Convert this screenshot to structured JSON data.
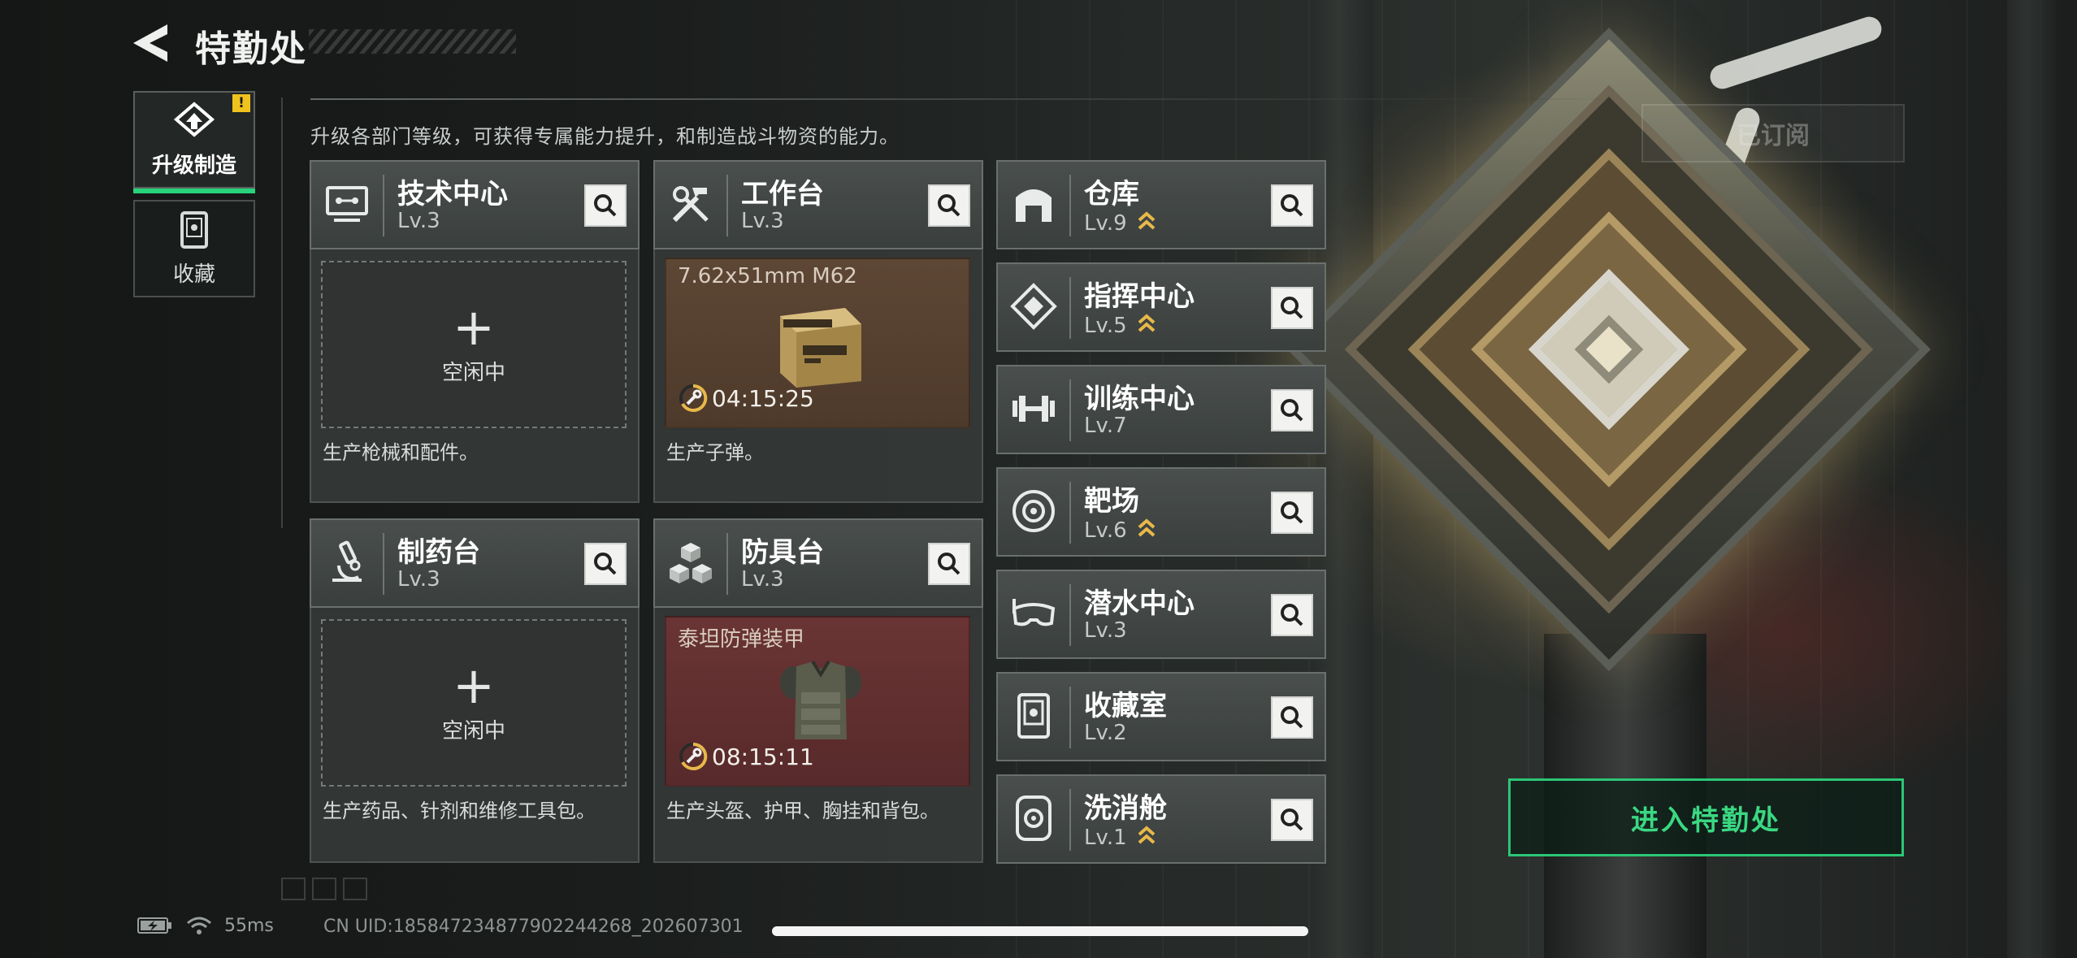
{
  "header": {
    "title": "特勤处"
  },
  "nav": {
    "tabs": [
      {
        "label": "升级制造",
        "active": true,
        "alert": "!"
      },
      {
        "label": "收藏",
        "active": false
      }
    ]
  },
  "subtitle": "升级各部门等级，可获得专属能力提升，和制造战斗物资的能力。",
  "workshops": [
    {
      "name": "技术中心",
      "level": "Lv.3",
      "icon": "monitor-icon",
      "status": "空闲中",
      "plus": "+",
      "desc": "生产枪械和配件。"
    },
    {
      "name": "工作台",
      "level": "Lv.3",
      "icon": "tools-icon",
      "product": "7.62x51mm M62",
      "timer": "04:15:25",
      "desc": "生产子弹。"
    },
    {
      "name": "制药台",
      "level": "Lv.3",
      "icon": "microscope-icon",
      "status": "空闲中",
      "plus": "+",
      "desc": "生产药品、针剂和维修工具包。"
    },
    {
      "name": "防具台",
      "level": "Lv.3",
      "icon": "cubes-icon",
      "product": "泰坦防弹装甲",
      "timer": "08:15:11",
      "desc": "生产头盔、护甲、胸挂和背包。"
    }
  ],
  "facilities": [
    {
      "name": "仓库",
      "level": "Lv.9",
      "upgradable": true,
      "icon": "warehouse-icon"
    },
    {
      "name": "指挥中心",
      "level": "Lv.5",
      "upgradable": true,
      "icon": "command-icon"
    },
    {
      "name": "训练中心",
      "level": "Lv.7",
      "upgradable": false,
      "icon": "dumbbell-icon"
    },
    {
      "name": "靶场",
      "level": "Lv.6",
      "upgradable": true,
      "icon": "target-icon"
    },
    {
      "name": "潜水中心",
      "level": "Lv.3",
      "upgradable": false,
      "icon": "diving-mask-icon"
    },
    {
      "name": "收藏室",
      "level": "Lv.2",
      "upgradable": false,
      "icon": "collection-icon"
    },
    {
      "name": "洗消舱",
      "level": "Lv.1",
      "upgradable": true,
      "icon": "decon-icon"
    }
  ],
  "subscribed_label": "已订阅",
  "enter_button": "进入特勤处",
  "status": {
    "ping": "55ms",
    "uid": "CN UID:1858472348779022442​68_202607301",
    "battery": "charging",
    "wifi": "connected"
  },
  "colors": {
    "accent": "#2cc676",
    "alert": "#f0c21e",
    "upgrade": "#e8b84a"
  }
}
